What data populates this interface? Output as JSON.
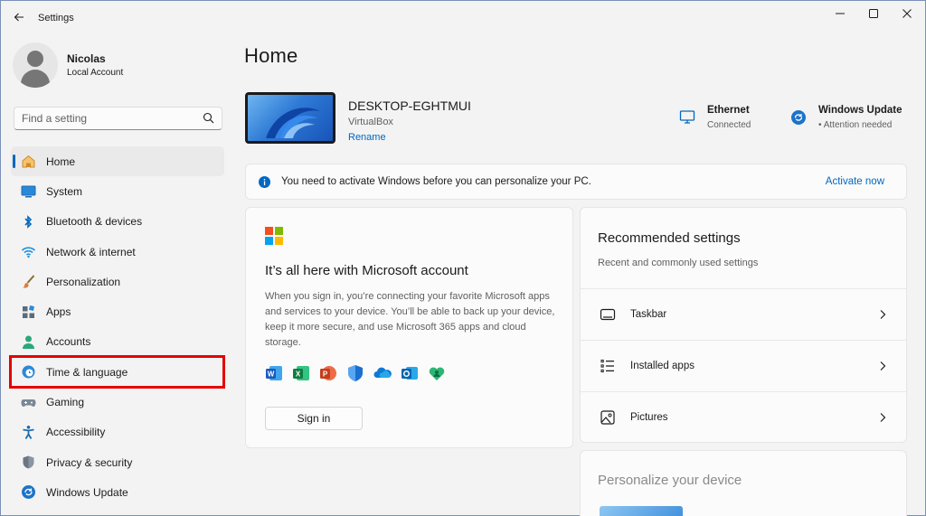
{
  "window": {
    "title": "Settings"
  },
  "profile": {
    "name": "Nicolas",
    "account_type": "Local Account"
  },
  "search": {
    "placeholder": "Find a setting"
  },
  "sidebar": {
    "items": [
      {
        "label": "Home",
        "icon": "home-icon",
        "active": true
      },
      {
        "label": "System",
        "icon": "system-icon"
      },
      {
        "label": "Bluetooth & devices",
        "icon": "bluetooth-icon"
      },
      {
        "label": "Network & internet",
        "icon": "wifi-icon"
      },
      {
        "label": "Personalization",
        "icon": "brush-icon"
      },
      {
        "label": "Apps",
        "icon": "apps-icon"
      },
      {
        "label": "Accounts",
        "icon": "person-icon"
      },
      {
        "label": "Time & language",
        "icon": "globe-clock-icon",
        "highlighted": true
      },
      {
        "label": "Gaming",
        "icon": "gamepad-icon"
      },
      {
        "label": "Accessibility",
        "icon": "accessibility-icon"
      },
      {
        "label": "Privacy & security",
        "icon": "shield-icon"
      },
      {
        "label": "Windows Update",
        "icon": "update-icon"
      }
    ]
  },
  "main": {
    "title": "Home",
    "device": {
      "name": "DESKTOP-EGHTMUI",
      "model": "VirtualBox",
      "rename_label": "Rename"
    },
    "ethernet": {
      "title": "Ethernet",
      "status": "Connected"
    },
    "windows_update": {
      "title": "Windows Update",
      "status": "• Attention needed"
    },
    "activation": {
      "message": "You need to activate Windows before you can personalize your PC.",
      "action_label": "Activate now"
    },
    "ms_account": {
      "title": "It’s all here with Microsoft account",
      "description": "When you sign in, you’re connecting your favorite Microsoft apps and services to your device. You’ll be able to back up your device, keep it more secure, and use Microsoft 365 apps and cloud storage.",
      "signin_label": "Sign in",
      "app_icons": [
        "word-icon",
        "excel-icon",
        "powerpoint-icon",
        "defender-icon",
        "onedrive-icon",
        "outlook-icon",
        "family-icon"
      ]
    },
    "recommended": {
      "title": "Recommended settings",
      "subtitle": "Recent and commonly used settings",
      "items": [
        {
          "label": "Taskbar",
          "icon": "taskbar-icon"
        },
        {
          "label": "Installed apps",
          "icon": "list-icon"
        },
        {
          "label": "Pictures",
          "icon": "picture-icon"
        }
      ]
    },
    "personalize": {
      "title": "Personalize your device"
    }
  },
  "colors": {
    "accent": "#0067c0",
    "highlight_box": "#e60000",
    "background": "#f3f3f3"
  }
}
